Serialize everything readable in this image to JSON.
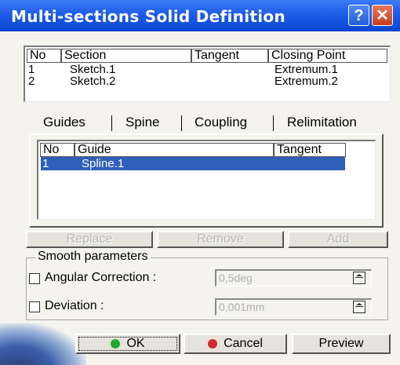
{
  "window": {
    "title": "Multi-sections Solid Definition",
    "help_label": "?",
    "close_label": "✕"
  },
  "sections_table": {
    "headers": [
      "No",
      "Section",
      "Tangent",
      "Closing Point"
    ],
    "rows": [
      {
        "no": "1",
        "section": "Sketch.1",
        "tangent": "",
        "closing": "Extremum.1"
      },
      {
        "no": "2",
        "section": "Sketch.2",
        "tangent": "",
        "closing": "Extremum.2"
      }
    ]
  },
  "tabs": [
    {
      "label": "Guides",
      "active": true
    },
    {
      "label": "Spine",
      "active": false
    },
    {
      "label": "Coupling",
      "active": false
    },
    {
      "label": "Relimitation",
      "active": false
    }
  ],
  "guides_table": {
    "headers": [
      "No",
      "Guide",
      "Tangent"
    ],
    "rows": [
      {
        "no": "1",
        "guide": "Spline.1",
        "tangent": "",
        "selected": true
      }
    ]
  },
  "action_buttons": {
    "replace": "Replace",
    "remove": "Remove",
    "add": "Add"
  },
  "smooth": {
    "group_label": "Smooth parameters",
    "angular_label": "Angular Correction :",
    "angular_value": "0,5deg",
    "deviation_label": "Deviation :",
    "deviation_value": "0,001mm"
  },
  "footer": {
    "ok": "OK",
    "cancel": "Cancel",
    "preview": "Preview"
  },
  "colors": {
    "title_bar": "#1d5ce6",
    "selection": "#2f5fb9",
    "ok_dot": "#1faa2e",
    "cancel_dot": "#d12b2b"
  }
}
